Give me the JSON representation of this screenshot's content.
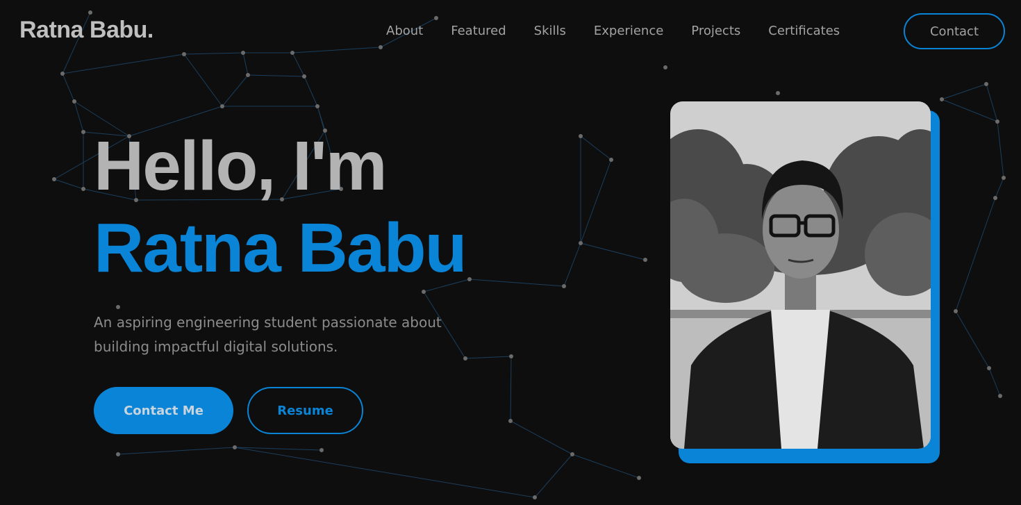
{
  "header": {
    "logo": "Ratna Babu.",
    "nav": [
      "About",
      "Featured",
      "Skills",
      "Experience",
      "Projects",
      "Certificates"
    ],
    "contact_label": "Contact"
  },
  "hero": {
    "greeting": "Hello, I'm",
    "name": "Ratna Babu",
    "tagline_line1": "An aspiring engineering student passionate about",
    "tagline_line2": "building impactful digital solutions.",
    "primary_button": "Contact Me",
    "secondary_button": "Resume"
  },
  "profile_photo": {
    "subject": "portrait of young man with glasses, grayscale"
  },
  "colors": {
    "background": "#0e0e0f",
    "accent": "#0a84d6",
    "text": "#b3b3b3",
    "muted": "#8c8c8c"
  }
}
